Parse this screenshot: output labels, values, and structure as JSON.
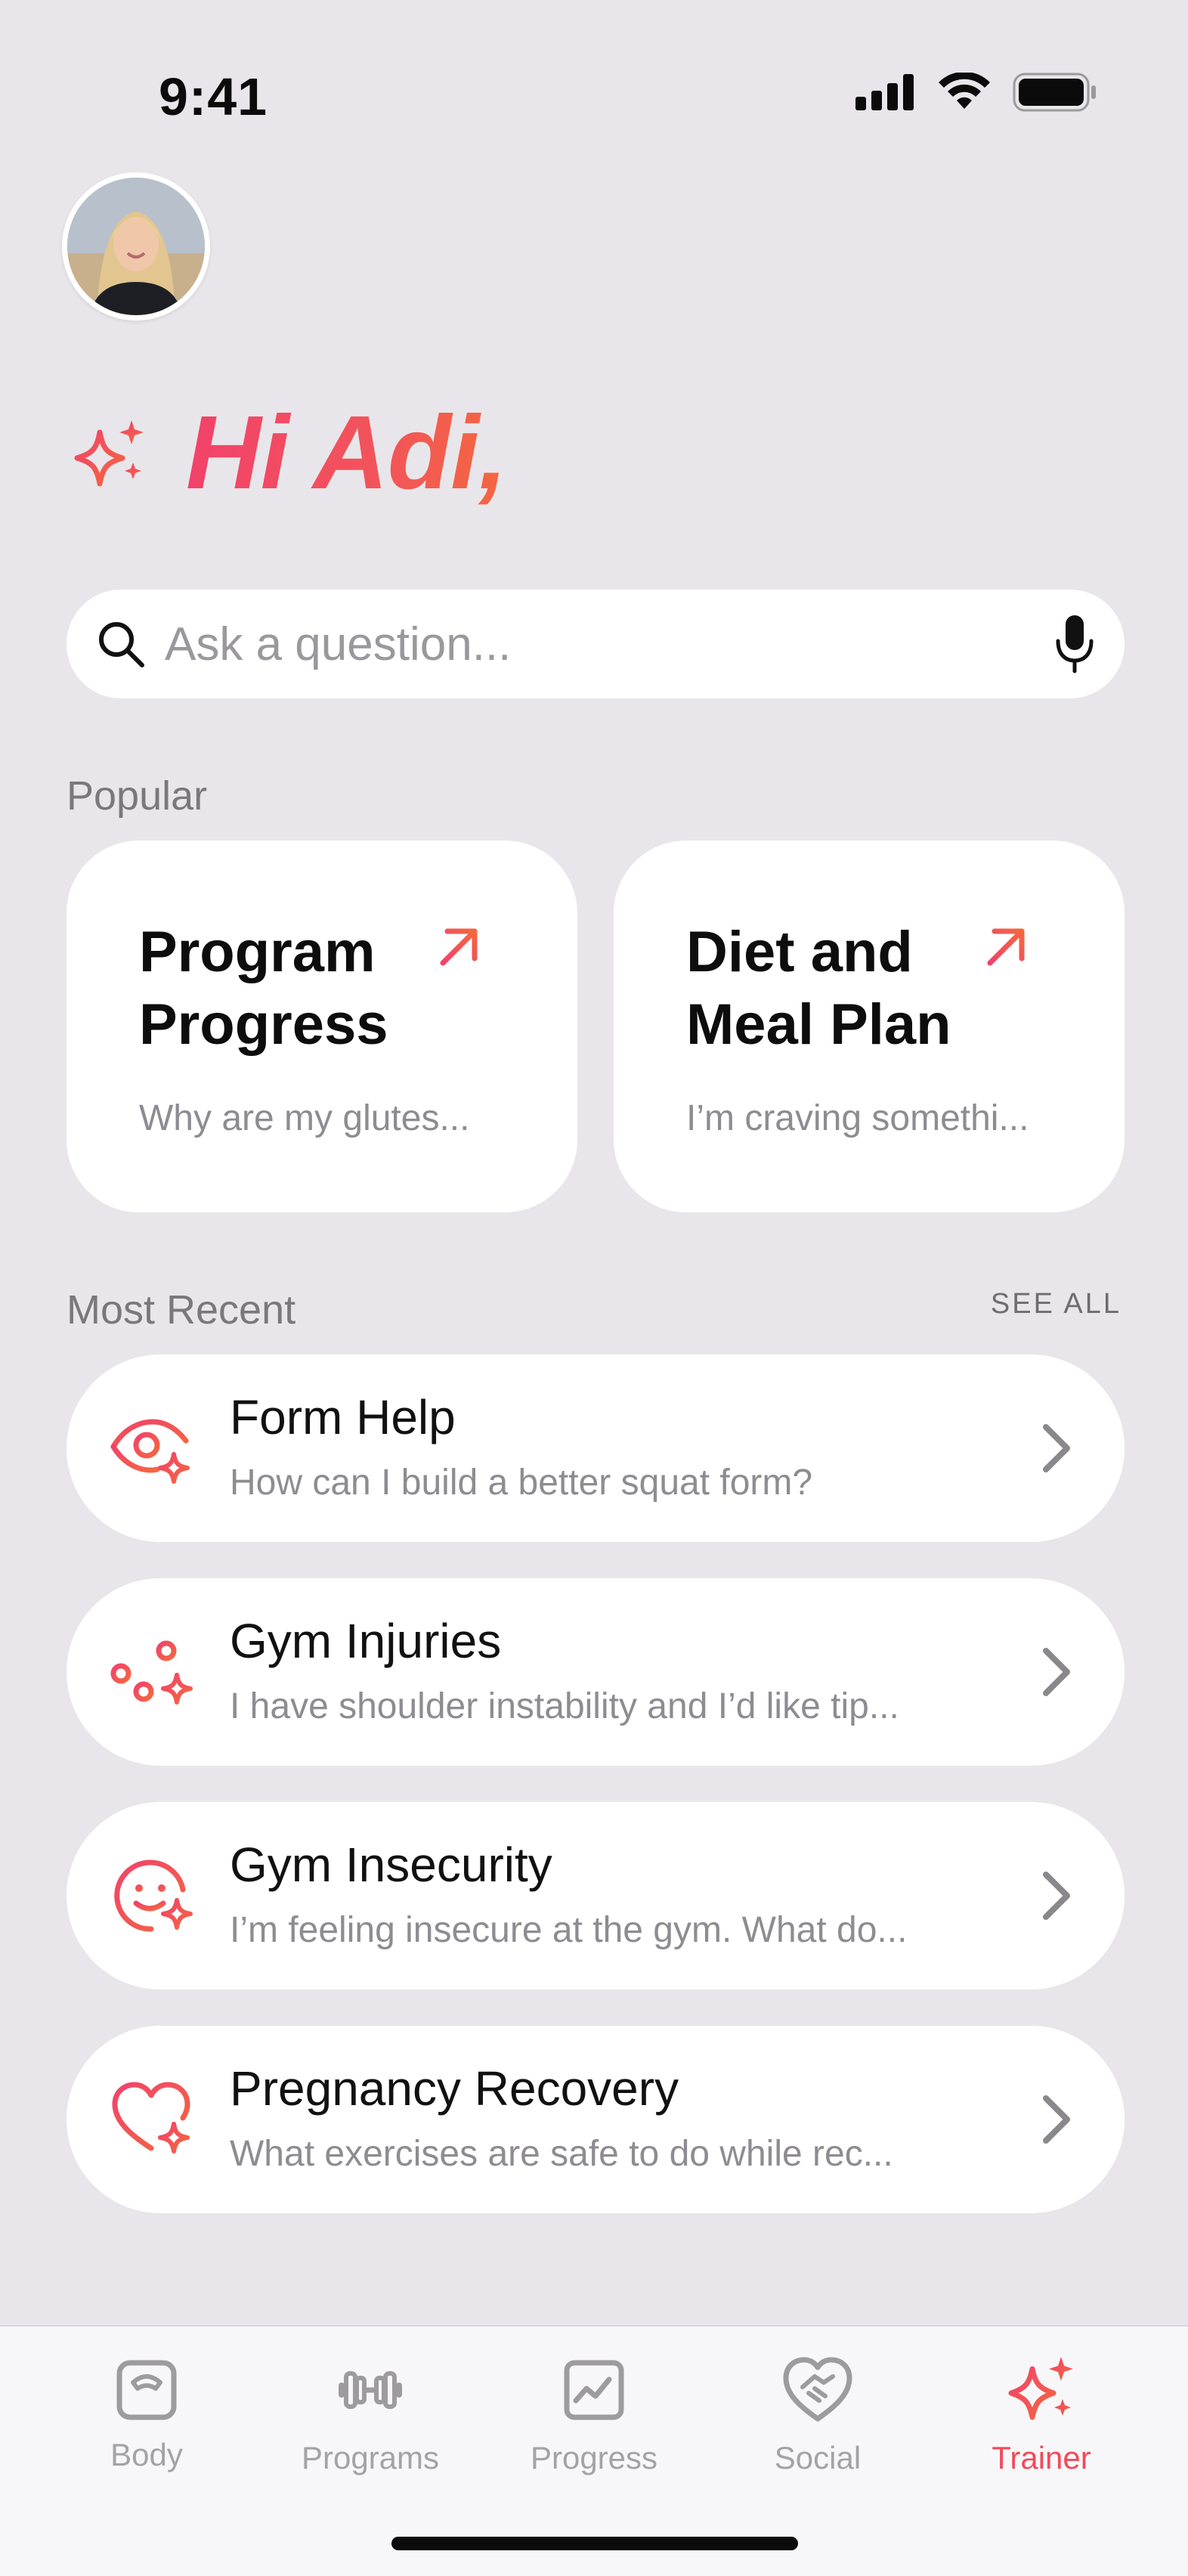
{
  "status": {
    "time": "9:41"
  },
  "greeting": {
    "text": "Hi Adi,"
  },
  "search": {
    "placeholder": "Ask a question..."
  },
  "popular": {
    "label": "Popular",
    "cards": [
      {
        "title": "Program Progress",
        "subtitle": "Why are my glutes..."
      },
      {
        "title": "Diet and Meal Plan",
        "subtitle": "I’m craving somethi..."
      }
    ]
  },
  "recent": {
    "label": "Most Recent",
    "see_all": "SEE ALL",
    "items": [
      {
        "title": "Form Help",
        "subtitle": "How can I build a better squat form?",
        "icon": "eye-sparkle-icon"
      },
      {
        "title": "Gym Injuries",
        "subtitle": "I have shoulder instability and I’d like tip...",
        "icon": "sliders-sparkle-icon"
      },
      {
        "title": "Gym Insecurity",
        "subtitle": "I’m feeling insecure at the gym. What do...",
        "icon": "smile-sparkle-icon"
      },
      {
        "title": "Pregnancy Recovery",
        "subtitle": "What exercises are safe to do while rec...",
        "icon": "heart-sparkle-icon"
      }
    ]
  },
  "tabs": [
    {
      "label": "Body",
      "icon": "scale-icon",
      "active": false
    },
    {
      "label": "Programs",
      "icon": "dumbbell-icon",
      "active": false
    },
    {
      "label": "Progress",
      "icon": "chart-icon",
      "active": false
    },
    {
      "label": "Social",
      "icon": "handshake-heart-icon",
      "active": false
    },
    {
      "label": "Trainer",
      "icon": "sparkles-icon",
      "active": true
    }
  ],
  "colors": {
    "accent": "#F24A5A",
    "accent_orange": "#F4673F",
    "background": "#E8E6EA"
  }
}
